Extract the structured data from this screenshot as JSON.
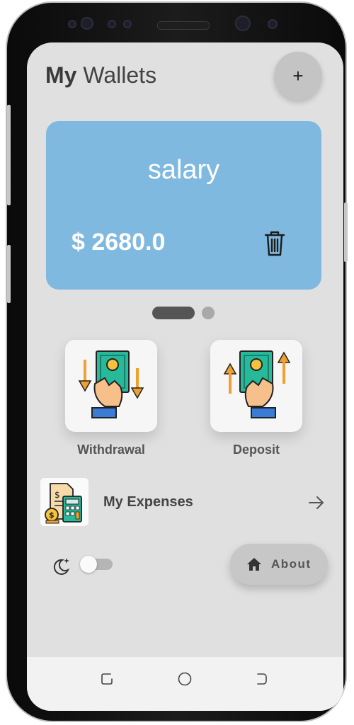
{
  "header": {
    "title_bold": "My",
    "title_rest": " Wallets",
    "add_label": "+"
  },
  "wallet_card": {
    "name": "salary",
    "amount": "$ 2680.0"
  },
  "carousel": {
    "pages": 2,
    "current": 1
  },
  "actions": [
    {
      "label": "Withdrawal",
      "icon": "withdrawal-icon"
    },
    {
      "label": "Deposit",
      "icon": "deposit-icon"
    }
  ],
  "expenses": {
    "label": "My Expenses",
    "icon": "calculator-receipt-icon",
    "arrow": "arrow-right-icon"
  },
  "theme_toggle": {
    "icon": "moon-icon",
    "enabled": false
  },
  "about_button": {
    "label": "About",
    "icon": "home-icon"
  },
  "colors": {
    "card": "#7fb9e0",
    "background": "#e0e0e0",
    "money_green": "#26b99a",
    "coin_yellow": "#f6c23e"
  }
}
